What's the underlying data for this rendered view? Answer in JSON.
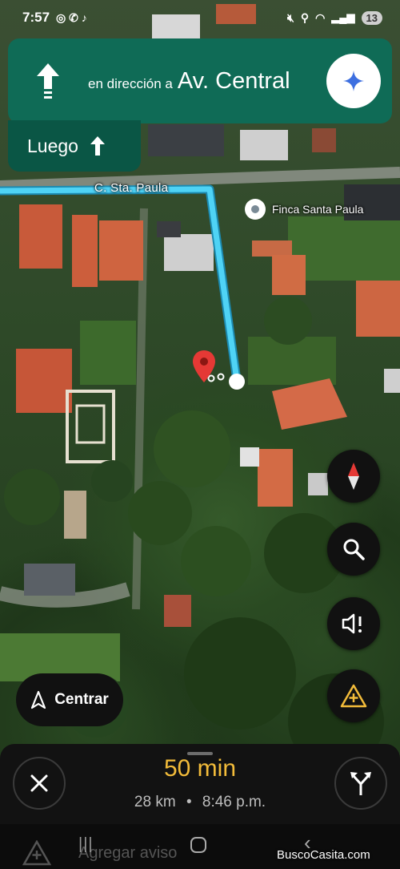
{
  "status_bar": {
    "time": "7:57",
    "battery": "13"
  },
  "navigation": {
    "direction_prefix": "en dirección a",
    "street": "Av. Central",
    "then_label": "Luego"
  },
  "map": {
    "street_label": "C. Sta. Paula",
    "place_label": "Finca Santa Paula",
    "route_color": "#4fd3f5",
    "pin_color": "#e53935"
  },
  "controls": {
    "center_label": "Centrar"
  },
  "trip": {
    "duration": "50 min",
    "distance": "28 km",
    "separator": "•",
    "arrival": "8:46 p.m."
  },
  "system_nav": {
    "report_label": "Agregar aviso",
    "recent_symbol": "|||"
  },
  "watermark": "BuscoCasita.com",
  "colors": {
    "banner": "#0f6b56",
    "eta": "#f3bc3a"
  }
}
